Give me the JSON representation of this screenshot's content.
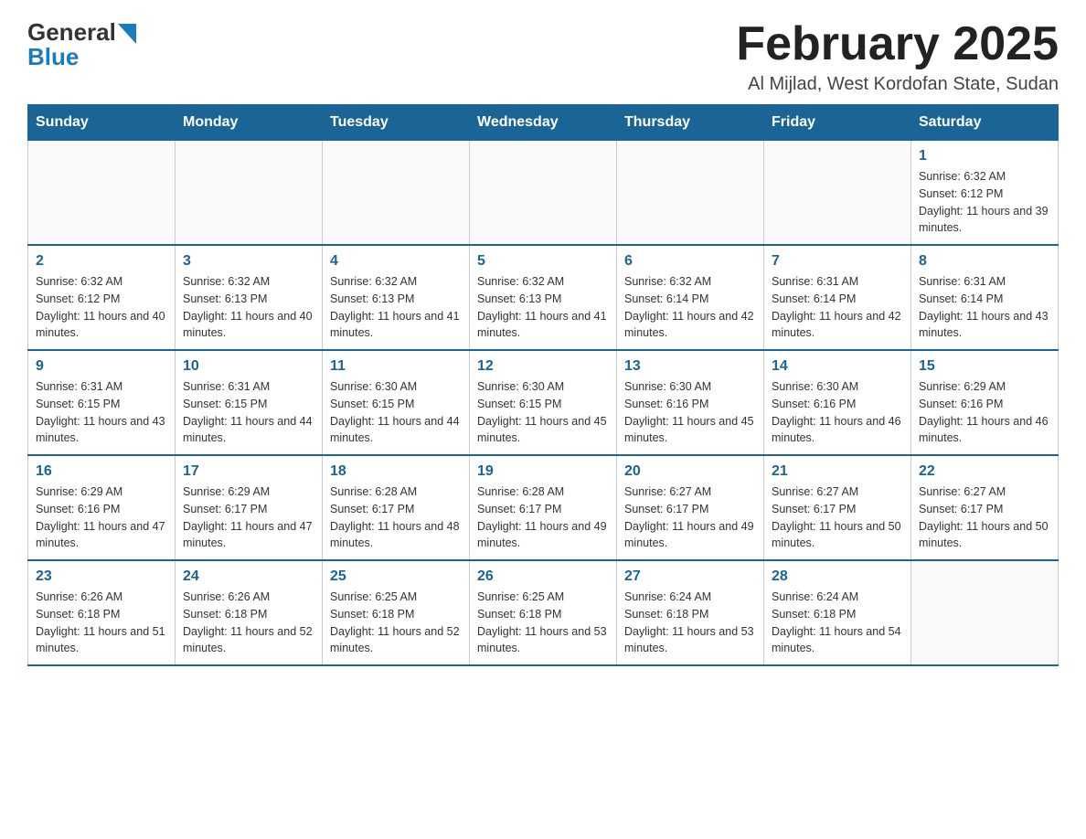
{
  "logo": {
    "text_general": "General",
    "text_blue": "Blue",
    "arrow_color": "#1a7bbf"
  },
  "title": {
    "month_year": "February 2025",
    "location": "Al Mijlad, West Kordofan State, Sudan"
  },
  "headers": [
    "Sunday",
    "Monday",
    "Tuesday",
    "Wednesday",
    "Thursday",
    "Friday",
    "Saturday"
  ],
  "weeks": [
    [
      {
        "day": "",
        "info": ""
      },
      {
        "day": "",
        "info": ""
      },
      {
        "day": "",
        "info": ""
      },
      {
        "day": "",
        "info": ""
      },
      {
        "day": "",
        "info": ""
      },
      {
        "day": "",
        "info": ""
      },
      {
        "day": "1",
        "info": "Sunrise: 6:32 AM\nSunset: 6:12 PM\nDaylight: 11 hours and 39 minutes."
      }
    ],
    [
      {
        "day": "2",
        "info": "Sunrise: 6:32 AM\nSunset: 6:12 PM\nDaylight: 11 hours and 40 minutes."
      },
      {
        "day": "3",
        "info": "Sunrise: 6:32 AM\nSunset: 6:13 PM\nDaylight: 11 hours and 40 minutes."
      },
      {
        "day": "4",
        "info": "Sunrise: 6:32 AM\nSunset: 6:13 PM\nDaylight: 11 hours and 41 minutes."
      },
      {
        "day": "5",
        "info": "Sunrise: 6:32 AM\nSunset: 6:13 PM\nDaylight: 11 hours and 41 minutes."
      },
      {
        "day": "6",
        "info": "Sunrise: 6:32 AM\nSunset: 6:14 PM\nDaylight: 11 hours and 42 minutes."
      },
      {
        "day": "7",
        "info": "Sunrise: 6:31 AM\nSunset: 6:14 PM\nDaylight: 11 hours and 42 minutes."
      },
      {
        "day": "8",
        "info": "Sunrise: 6:31 AM\nSunset: 6:14 PM\nDaylight: 11 hours and 43 minutes."
      }
    ],
    [
      {
        "day": "9",
        "info": "Sunrise: 6:31 AM\nSunset: 6:15 PM\nDaylight: 11 hours and 43 minutes."
      },
      {
        "day": "10",
        "info": "Sunrise: 6:31 AM\nSunset: 6:15 PM\nDaylight: 11 hours and 44 minutes."
      },
      {
        "day": "11",
        "info": "Sunrise: 6:30 AM\nSunset: 6:15 PM\nDaylight: 11 hours and 44 minutes."
      },
      {
        "day": "12",
        "info": "Sunrise: 6:30 AM\nSunset: 6:15 PM\nDaylight: 11 hours and 45 minutes."
      },
      {
        "day": "13",
        "info": "Sunrise: 6:30 AM\nSunset: 6:16 PM\nDaylight: 11 hours and 45 minutes."
      },
      {
        "day": "14",
        "info": "Sunrise: 6:30 AM\nSunset: 6:16 PM\nDaylight: 11 hours and 46 minutes."
      },
      {
        "day": "15",
        "info": "Sunrise: 6:29 AM\nSunset: 6:16 PM\nDaylight: 11 hours and 46 minutes."
      }
    ],
    [
      {
        "day": "16",
        "info": "Sunrise: 6:29 AM\nSunset: 6:16 PM\nDaylight: 11 hours and 47 minutes."
      },
      {
        "day": "17",
        "info": "Sunrise: 6:29 AM\nSunset: 6:17 PM\nDaylight: 11 hours and 47 minutes."
      },
      {
        "day": "18",
        "info": "Sunrise: 6:28 AM\nSunset: 6:17 PM\nDaylight: 11 hours and 48 minutes."
      },
      {
        "day": "19",
        "info": "Sunrise: 6:28 AM\nSunset: 6:17 PM\nDaylight: 11 hours and 49 minutes."
      },
      {
        "day": "20",
        "info": "Sunrise: 6:27 AM\nSunset: 6:17 PM\nDaylight: 11 hours and 49 minutes."
      },
      {
        "day": "21",
        "info": "Sunrise: 6:27 AM\nSunset: 6:17 PM\nDaylight: 11 hours and 50 minutes."
      },
      {
        "day": "22",
        "info": "Sunrise: 6:27 AM\nSunset: 6:17 PM\nDaylight: 11 hours and 50 minutes."
      }
    ],
    [
      {
        "day": "23",
        "info": "Sunrise: 6:26 AM\nSunset: 6:18 PM\nDaylight: 11 hours and 51 minutes."
      },
      {
        "day": "24",
        "info": "Sunrise: 6:26 AM\nSunset: 6:18 PM\nDaylight: 11 hours and 52 minutes."
      },
      {
        "day": "25",
        "info": "Sunrise: 6:25 AM\nSunset: 6:18 PM\nDaylight: 11 hours and 52 minutes."
      },
      {
        "day": "26",
        "info": "Sunrise: 6:25 AM\nSunset: 6:18 PM\nDaylight: 11 hours and 53 minutes."
      },
      {
        "day": "27",
        "info": "Sunrise: 6:24 AM\nSunset: 6:18 PM\nDaylight: 11 hours and 53 minutes."
      },
      {
        "day": "28",
        "info": "Sunrise: 6:24 AM\nSunset: 6:18 PM\nDaylight: 11 hours and 54 minutes."
      },
      {
        "day": "",
        "info": ""
      }
    ]
  ]
}
